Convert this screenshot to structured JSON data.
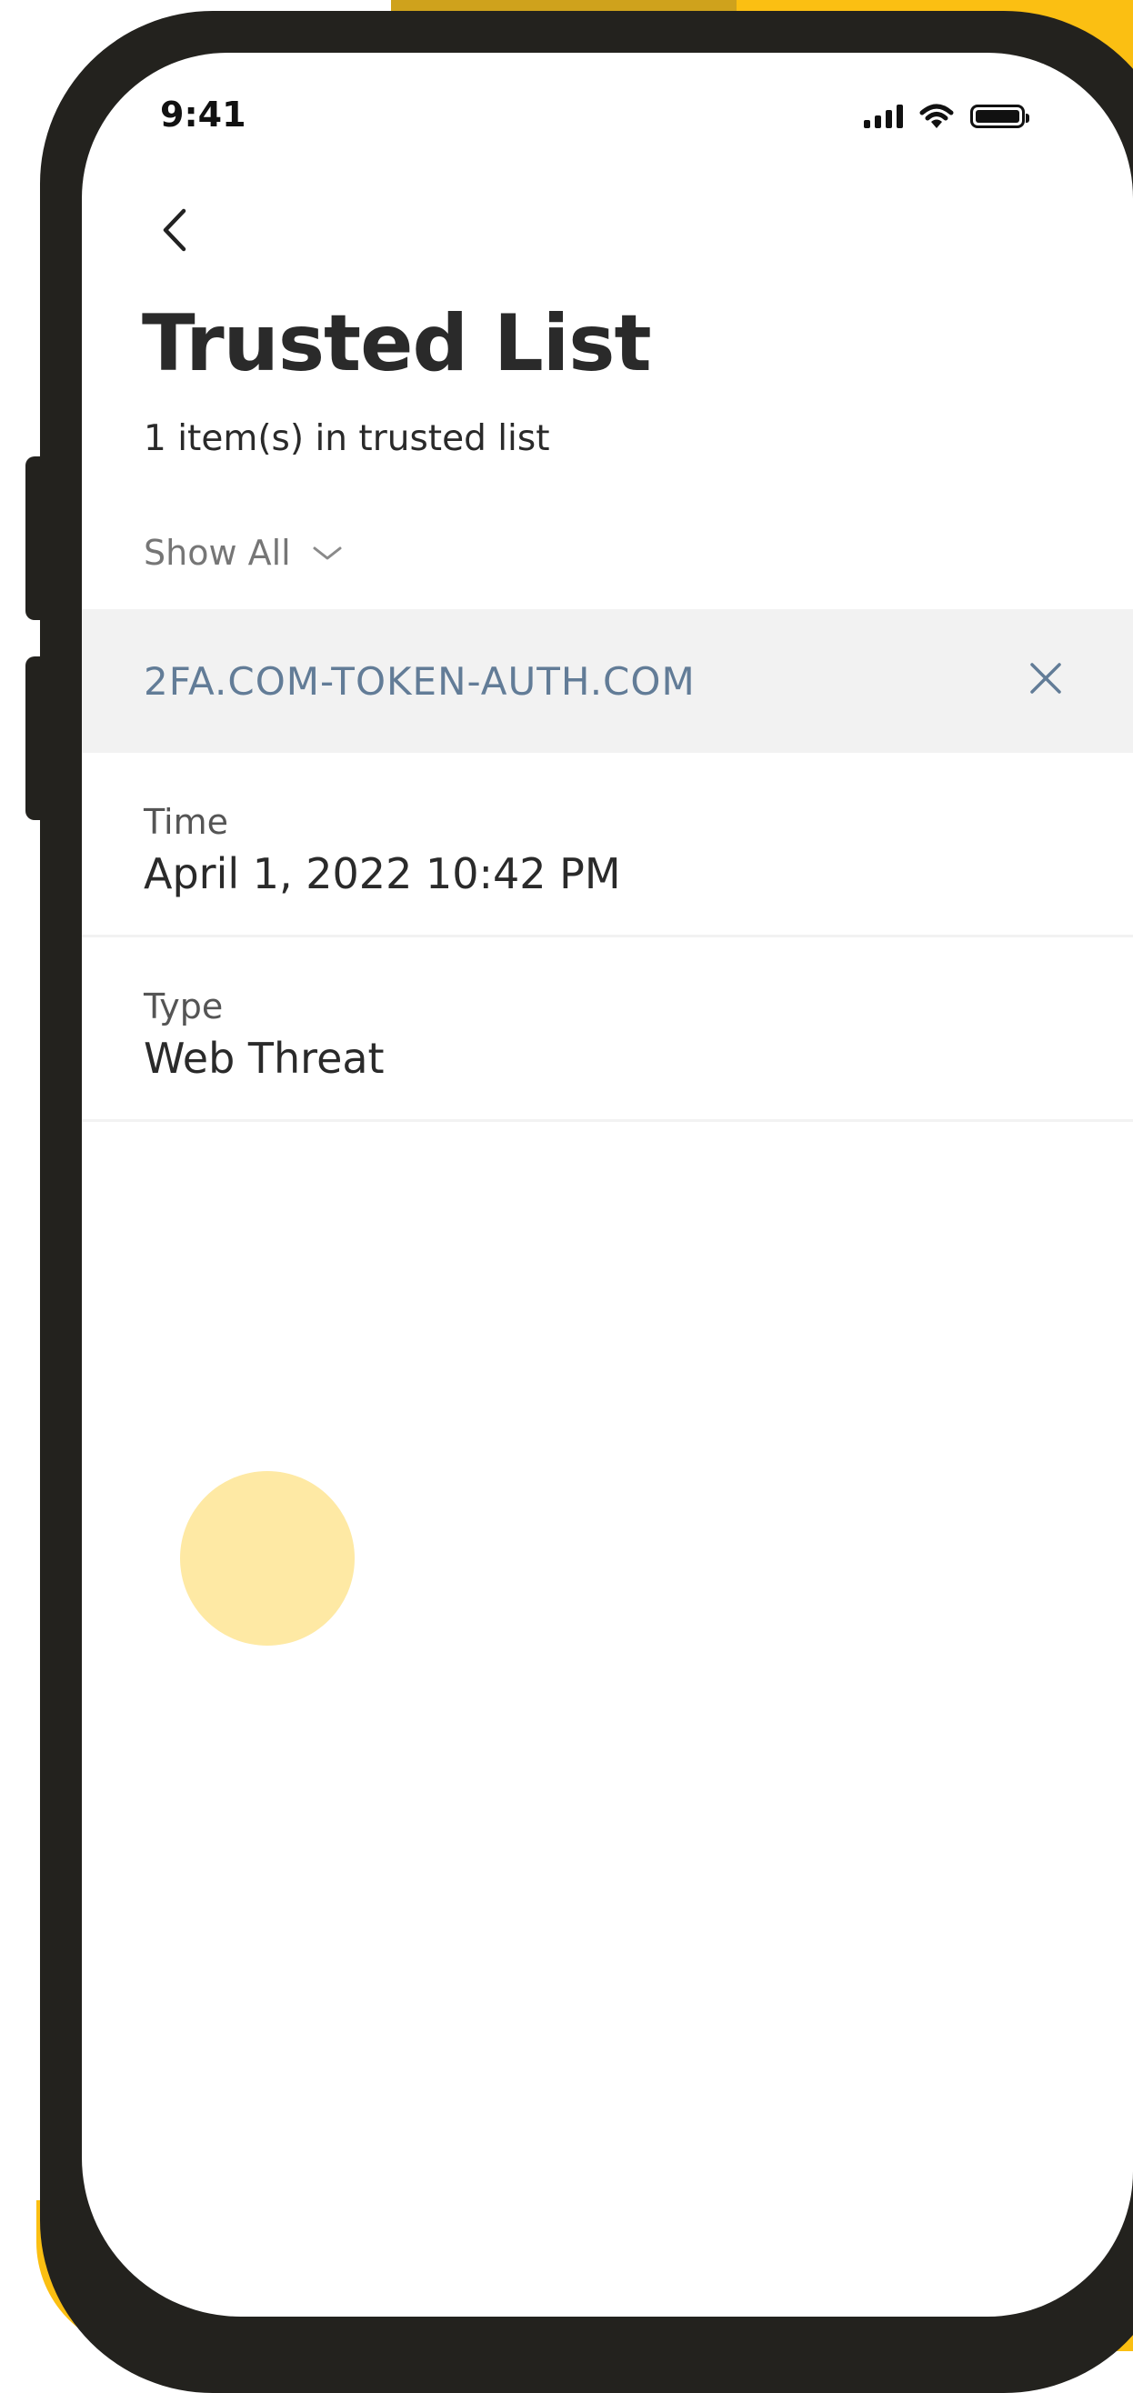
{
  "status_bar": {
    "time": "9:41",
    "icons": [
      "cellular-signal-icon",
      "wifi-icon",
      "battery-icon"
    ]
  },
  "header": {
    "back_icon": "chevron-left-icon",
    "title": "Trusted List",
    "subtitle": "1 item(s) in trusted list"
  },
  "filter": {
    "label": "Show All",
    "icon": "chevron-down-icon"
  },
  "items": [
    {
      "domain": "2FA.COM-TOKEN-AUTH.COM",
      "remove_icon": "close-icon",
      "details": [
        {
          "label": "Time",
          "value": "April 1, 2022 10:42 PM"
        },
        {
          "label": "Type",
          "value": "Web Threat"
        }
      ]
    }
  ],
  "colors": {
    "accent_yellow": "#fbbf12",
    "domain_text": "#627c97",
    "header_bg": "#f2f2f2",
    "touch_indicator": "#fee9a4",
    "phone_frame": "#23221e"
  }
}
